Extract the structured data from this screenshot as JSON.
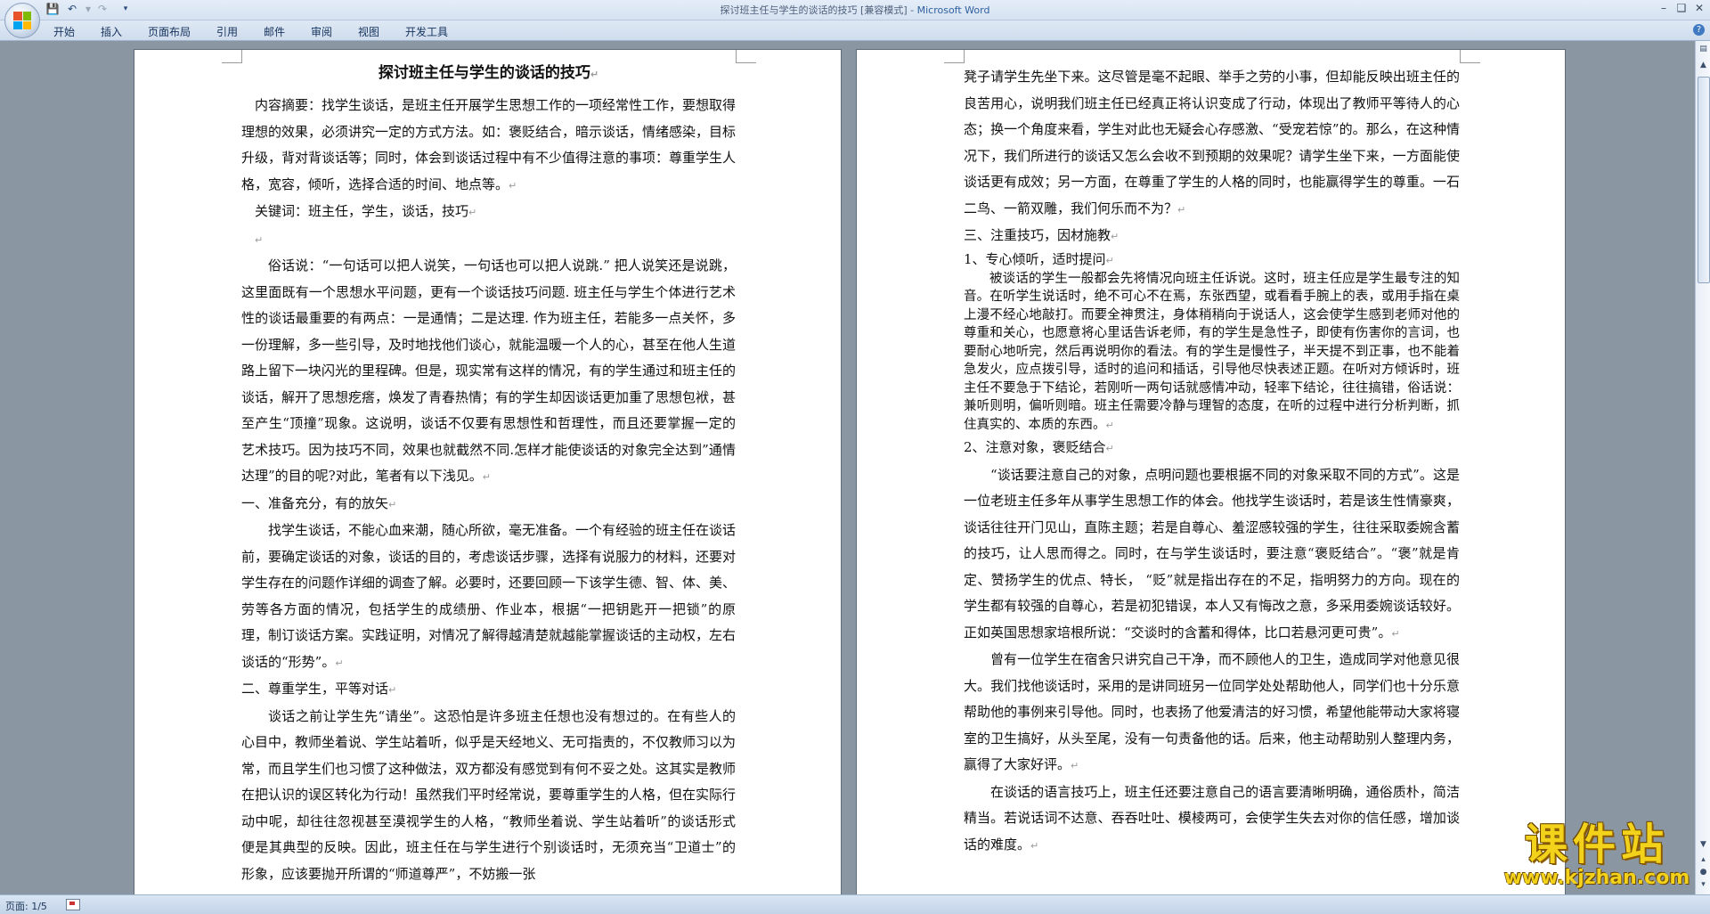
{
  "window": {
    "doc_title": "探讨班主任与学生的谈话的技巧 [兼容模式]",
    "separator": " - ",
    "app_name": "Microsoft Word"
  },
  "tabs": [
    "开始",
    "插入",
    "页面布局",
    "引用",
    "邮件",
    "审阅",
    "视图",
    "开发工具"
  ],
  "left_page": {
    "title": "探讨班主任与学生的谈话的技巧",
    "paragraphs": [
      "内容摘要：找学生谈话，是班主任开展学生思想工作的一项经常性工作，要想取得理想的效果，必须讲究一定的方式方法。如：褒贬结合，暗示谈话，情绪感染，目标升级，背对背谈话等；同时，体会到谈话过程中有不少值得注意的事项：尊重学生人格，宽容，倾听，选择合适的时间、地点等。",
      "关键词：班主任，学生，谈话，技巧",
      "",
      "俗话说：“一句话可以把人说笑，一句话也可以把人说跳.” 把人说笑还是说跳，这里面既有一个思想水平问题，更有一个谈话技巧问题. 班主任与学生个体进行艺术性的谈话最重要的有两点：一是通情；二是达理. 作为班主任，若能多一点关怀，多一份理解，多一些引导，及时地找他们谈心，就能温暖一个人的心，甚至在他人生道路上留下一块闪光的里程碑。但是，现实常有这样的情况，有的学生通过和班主任的谈话，解开了思想疙瘩，焕发了青春热情；有的学生却因谈话更加重了思想包袱，甚至产生“顶撞”现象。这说明，谈话不仅要有思想性和哲理性，而且还要掌握一定的艺术技巧。因为技巧不同，效果也就截然不同.怎样才能使谈话的对象完全达到”通情达理”的目的呢?对此，笔者有以下浅见。",
      "一、准备充分，有的放矢",
      "找学生谈话，不能心血来潮，随心所欲，毫无准备。一个有经验的班主任在谈话前，要确定谈话的对象，谈话的目的，考虑谈话步骤，选择有说服力的材料，还要对学生存在的问题作详细的调查了解。必要时，还要回顾一下该学生德、智、体、美、劳等各方面的情况，包括学生的成绩册、作业本，根据“一把钥匙开一把锁”的原理，制订谈话方案。实践证明，对情况了解得越清楚就越能掌握谈话的主动权，左右谈话的“形势”。",
      "二、尊重学生，平等对话",
      "谈话之前让学生先“请坐”。这恐怕是许多班主任想也没有想过的。在有些人的心目中，教师坐着说、学生站着听，似乎是天经地义、无可指责的，不仅教师习以为常，而且学生们也习惯了这种做法，双方都没有感觉到有何不妥之处。这其实是教师在把认识的误区转化为行动！虽然我们平时经常说，要尊重学生的人格，但在实际行动中呢，却往往忽视甚至漠视学生的人格，“教师坐着说、学生站着听”的谈话形式便是其典型的反映。因此，班主任在与学生进行个别谈话时，无须充当“卫道士”的形象，应该要抛开所谓的“师道尊严”，不妨搬一张"
    ]
  },
  "right_page": {
    "paragraphs": [
      "凳子请学生先坐下来。这尽管是毫不起眼、举手之劳的小事，但却能反映出班主任的良苦用心，说明我们班主任已经真正将认识变成了行动，体现出了教师平等待人的心态；换一个角度来看，学生对此也无疑会心存感激、“受宠若惊”的。那么，在这种情况下，我们所进行的谈话又怎么会收不到预期的效果呢？请学生坐下来，一方面能使谈话更有成效；另一方面，在尊重了学生的人格的同时，也能赢得学生的尊重。一石二鸟、一箭双雕，我们何乐而不为？",
      "三、注重技巧，因材施教",
      "1、专心倾听，适时提问",
      "被谈话的学生一般都会先将情况向班主任诉说。这时，班主任应是学生最专注的知音。在听学生说话时，绝不可心不在焉，东张西望，或看看手腕上的表，或用手指在桌上漫不经心地敲打。而要全神贯注，身体稍稍向于说话人，这会使学生感到老师对他的尊重和关心，也愿意将心里话告诉老师，有的学生是急性子，即使有伤害你的言词，也要耐心地听完，然后再说明你的看法。有的学生是慢性子，半天提不到正事，也不能着急发火，应点拨引导，适时的追问和插话，引导他尽快表述正题。在听对方倾诉时，班主任不要急于下结论，若刚听一两句话就感情冲动，轻率下结论，往往搞错，俗话说：兼听则明，偏听则暗。班主任需要冷静与理智的态度，在听的过程中进行分析判断，抓住真实的、本质的东西。",
      "2、注意对象，褒贬结合",
      "“谈话要注意自己的对象，点明问题也要根据不同的对象采取不同的方式”。这是一位老班主任多年从事学生思想工作的体会。他找学生谈话时，若是该生性情豪爽，谈话往往开门见山，直陈主题；若是自尊心、羞涩感较强的学生，往往采取委婉含蓄的技巧，让人思而得之。同时，在与学生谈话时，要注意“褒贬结合”。“褒”就是肯定、赞扬学生的优点、特长， “贬”就是指出存在的不足，指明努力的方向。现在的学生都有较强的自尊心，若是初犯错误，本人又有悔改之意，多采用委婉谈话较好。正如英国思想家培根所说：“交谈时的含蓄和得体，比口若悬河更可贵”。",
      "曾有一位学生在宿舍只讲究自己干净，而不顾他人的卫生，造成同学对他意见很大。我们找他谈话时，采用的是讲同班另一位同学处处帮助他人，同学们也十分乐意帮助他的事例来引导他。同时，也表扬了他爱清洁的好习惯，希望他能带动大家将寝室的卫生搞好，从头至尾，没有一句责备他的话。后来，他主动帮助别人整理内务，赢得了大家好评。",
      "在谈话的语言技巧上，班主任还要注意自己的语言要清晰明确，通俗质朴，简洁精当。若说话词不达意、吞吞吐吐、模棱两可，会使学生失去对你的信任感，增加谈话的难度。"
    ]
  },
  "status": {
    "page_indicator": "页面: 1/5"
  },
  "watermark": {
    "text": "课件站",
    "url": "www.kjzhan.com"
  },
  "icons": {
    "save": "save-icon",
    "undo": "undo-icon",
    "redo": "redo-icon",
    "customize": "qat-dropdown-icon",
    "help": "help-icon",
    "proofing": "proofing-icon"
  }
}
